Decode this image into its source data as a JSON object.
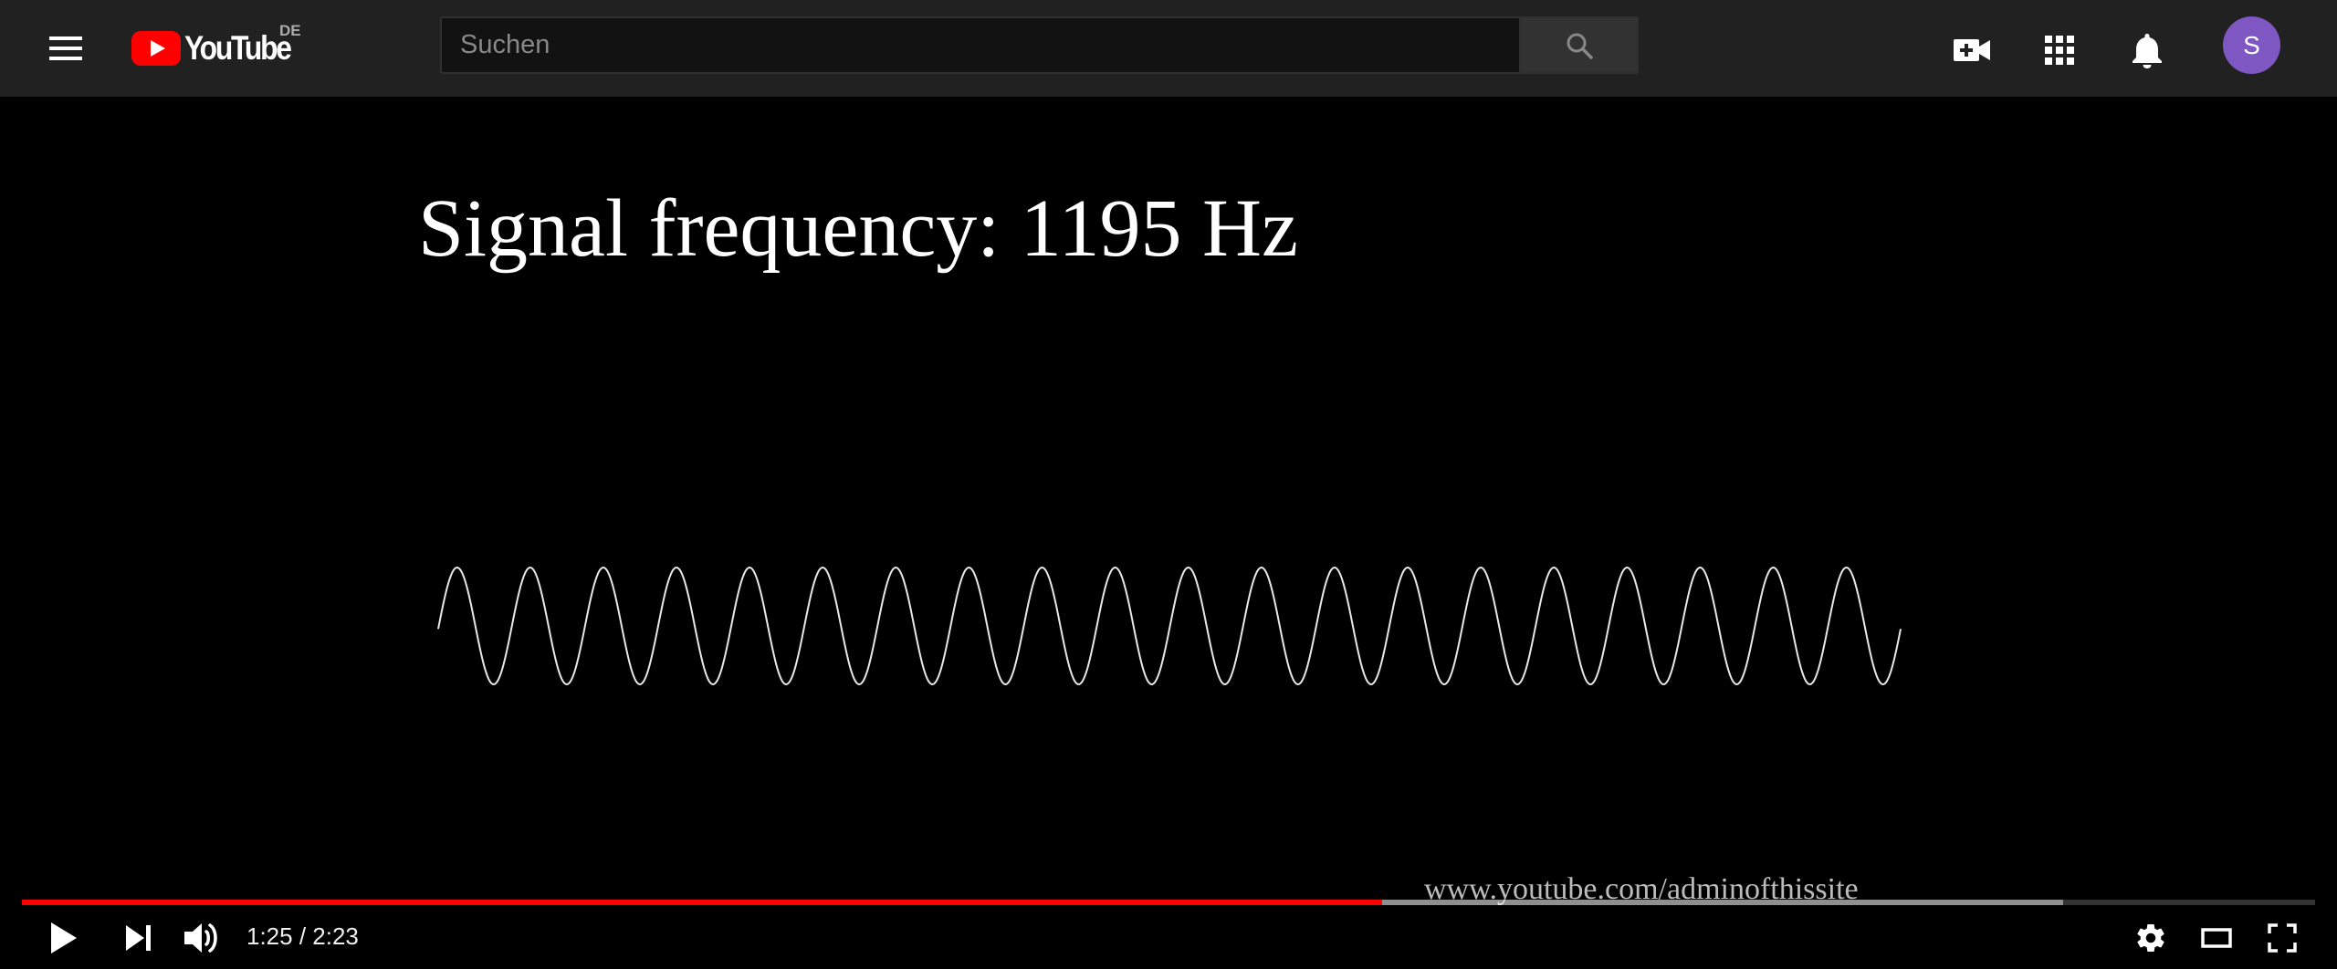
{
  "masthead": {
    "logo_text": "YouTube",
    "country_code": "DE",
    "search_placeholder": "Suchen",
    "avatar_letter": "S",
    "icons": [
      "menu-icon",
      "search-icon",
      "video-camera-add-icon",
      "apps-grid-icon",
      "bell-icon"
    ],
    "brand_color": "#ff0000",
    "avatar_color": "#7e57c2"
  },
  "video": {
    "title_overlay": "Signal frequency: 1195 Hz",
    "watermark": "www.youtube.com/adminofthissite",
    "waveform_cycles": 20
  },
  "player": {
    "current_time": "1:25",
    "duration": "2:23",
    "time_display": "1:25 / 2:23",
    "played_fraction": 0.593,
    "buffered_fraction": 0.89,
    "progress_color": "#ff0000",
    "icons": [
      "play-icon",
      "next-icon",
      "volume-icon",
      "settings-icon",
      "theater-mode-icon",
      "fullscreen-icon"
    ]
  }
}
